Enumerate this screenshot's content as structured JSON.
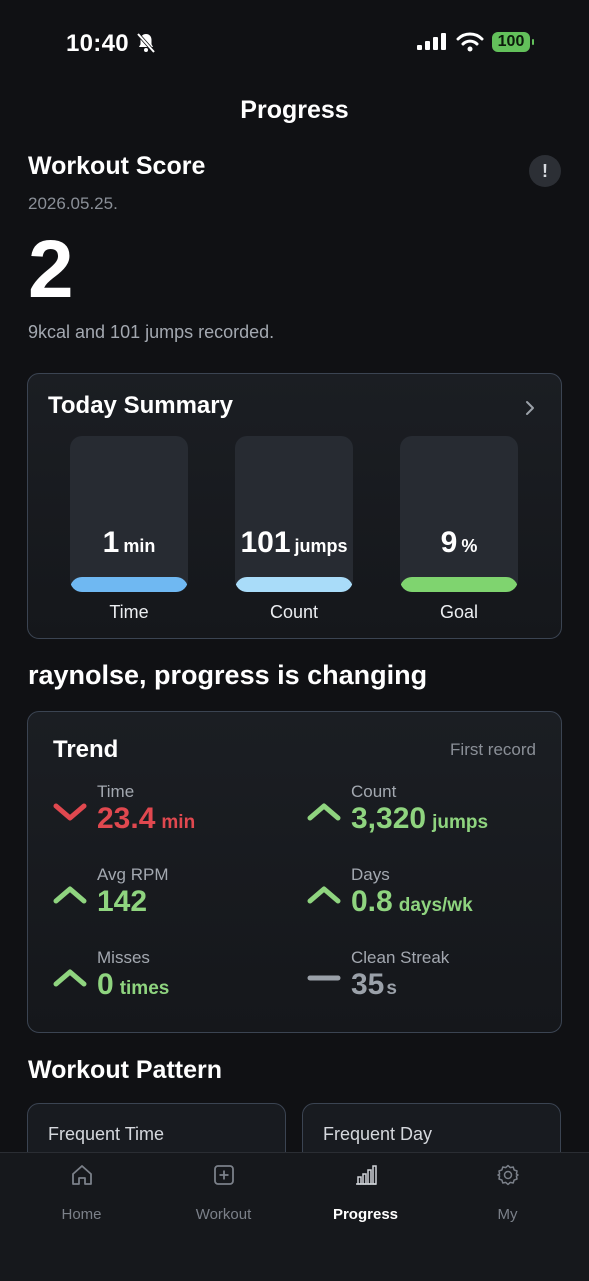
{
  "status": {
    "time": "10:40",
    "battery": "100"
  },
  "header": {
    "title": "Progress"
  },
  "score": {
    "title": "Workout Score",
    "info_glyph": "!",
    "date": "2026.05.25.",
    "value": "2",
    "description": "9kcal and 101 jumps recorded."
  },
  "summary": {
    "title": "Today Summary",
    "items": [
      {
        "value": "1",
        "unit": "min",
        "label": "Time",
        "color": "#6fb8f2"
      },
      {
        "value": "101",
        "unit": "jumps",
        "label": "Count",
        "color": "#a9dcf9"
      },
      {
        "value": "9",
        "unit": "%",
        "label": "Goal",
        "color": "#7fd46f"
      }
    ]
  },
  "headline": "raynolse, progress is changing",
  "trend": {
    "title": "Trend",
    "first_record": "First record",
    "metrics": [
      {
        "label": "Time",
        "value": "23.4",
        "unit": "min",
        "direction": "down"
      },
      {
        "label": "Count",
        "value": "3,320",
        "unit": "jumps",
        "direction": "up"
      },
      {
        "label": "Avg RPM",
        "value": "142",
        "unit": "",
        "direction": "up"
      },
      {
        "label": "Days",
        "value": "0.8",
        "unit": "days/wk",
        "direction": "up"
      },
      {
        "label": "Misses",
        "value": "0",
        "unit": "times",
        "direction": "up"
      },
      {
        "label": "Clean Streak",
        "value": "35",
        "unit": "s",
        "direction": "flat"
      }
    ]
  },
  "pattern": {
    "title": "Workout Pattern",
    "cards": [
      "Frequent Time",
      "Frequent Day"
    ]
  },
  "tabs": [
    {
      "label": "Home",
      "icon": "home-icon"
    },
    {
      "label": "Workout",
      "icon": "plus-square-icon"
    },
    {
      "label": "Progress",
      "icon": "bar-chart-icon"
    },
    {
      "label": "My",
      "icon": "gear-icon"
    }
  ]
}
